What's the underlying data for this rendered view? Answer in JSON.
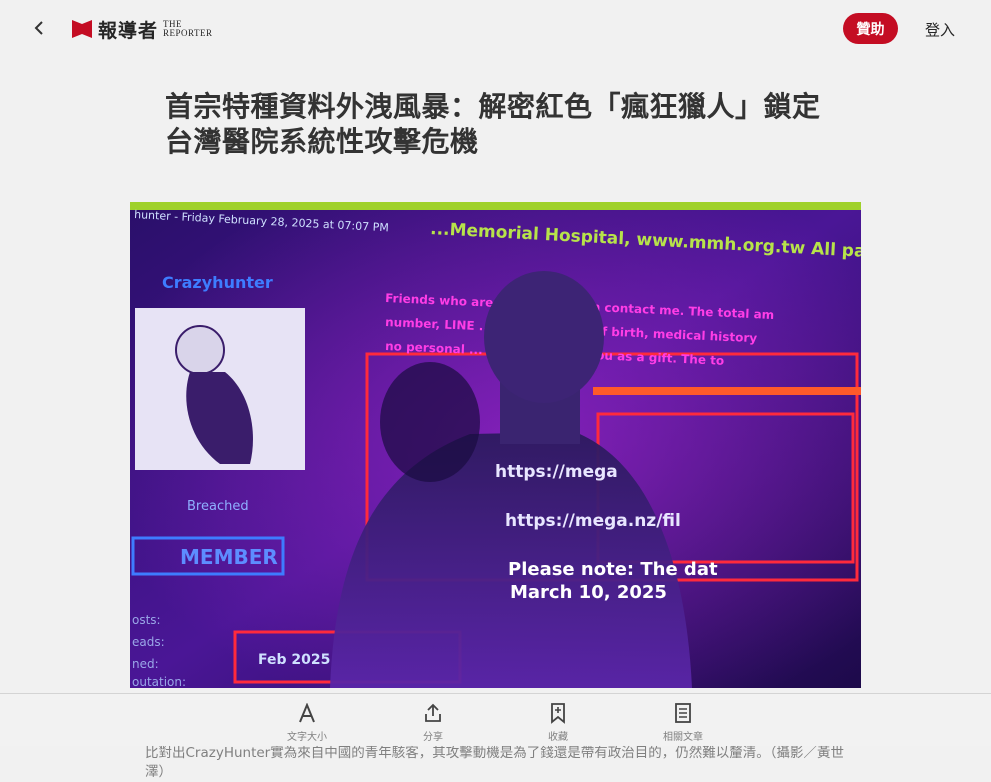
{
  "header": {
    "logo_cn": "報導者",
    "logo_en_line1": "THE",
    "logo_en_line2": "REPORTER",
    "donate_label": "贊助",
    "login_label": "登入"
  },
  "article": {
    "title": "首宗特種資料外洩風暴：解密紅色「瘋狂獵人」鎖定台灣醫院系統性攻擊危機",
    "caption": "比對出CrazyHunter實為來自中國的青年駭客，其攻擊動機是為了錢還是帶有政治目的，仍然難以釐清。（攝影／黃世澤）"
  },
  "hero_image": {
    "top_banner": "...Memorial Hospital, www.mmh.org.tw All patient data",
    "left_banner": "hunter - Friday February 28, 2025 at 07:07 PM",
    "profile_name": "Crazyhunter",
    "breached_label": "Breached",
    "member_label": "MEMBER",
    "side_labels": [
      "osts:",
      "eads:",
      "ned:",
      "outation:"
    ],
    "date_label": "Feb 2025",
    "projected_lines": [
      "https://mega",
      "https://mega.nz/fil",
      "Please note: The dat",
      "March 10, 2025"
    ],
    "body_text_1": "Friends who are ... the data can contact me. The total am",
    "body_text_2": "number, LINE ... address, date of birth, medical history",
    "body_text_3": "no personal ... I can give it to you as a gift. The to"
  },
  "toolbar": {
    "font_size_label": "文字大小",
    "share_label": "分享",
    "bookmark_label": "收藏",
    "related_label": "相關文章"
  },
  "colors": {
    "brand_red": "#c40d23",
    "background": "#f1f1f1",
    "title_text": "#333333",
    "muted_text": "#808080"
  }
}
